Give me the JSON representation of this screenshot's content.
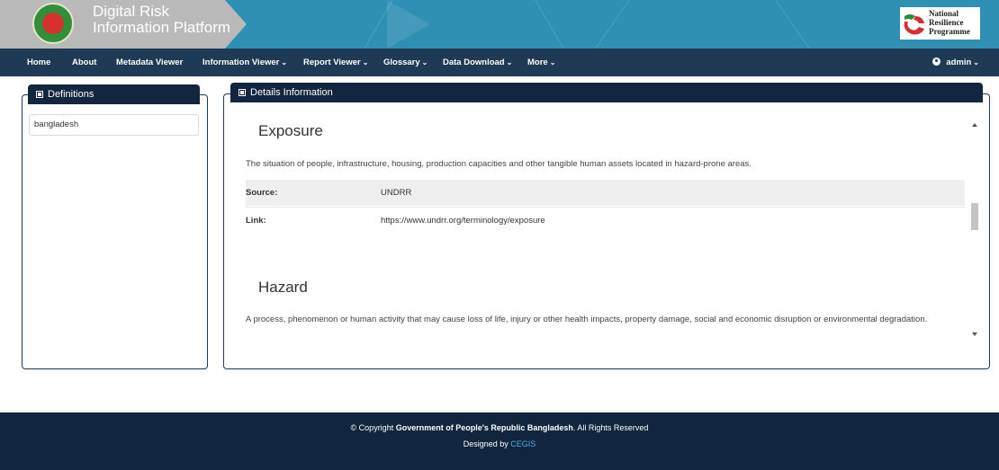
{
  "header": {
    "brand_line1": "Digital Risk",
    "brand_line2": "Information Platform",
    "partner_line1": "National",
    "partner_line2": "Resilience",
    "partner_line3": "Programme"
  },
  "nav": {
    "items": [
      {
        "label": "Home",
        "dropdown": false
      },
      {
        "label": "About",
        "dropdown": false
      },
      {
        "label": "Metadata Viewer",
        "dropdown": false
      },
      {
        "label": "Information Viewer",
        "dropdown": true
      },
      {
        "label": "Report Viewer",
        "dropdown": true
      },
      {
        "label": "Glossary",
        "dropdown": true
      },
      {
        "label": "Data Download",
        "dropdown": true
      },
      {
        "label": "More",
        "dropdown": true
      }
    ],
    "caret": "⌄",
    "user_label": "admin"
  },
  "definitions": {
    "title": "Definitions",
    "items": [
      "bangladesh"
    ]
  },
  "details": {
    "title": "Details Information",
    "entries": [
      {
        "term": "Exposure",
        "description": "The situation of people, infrastructure, housing, production capacities and other tangible human assets located in hazard-prone areas.",
        "source_label": "Source:",
        "source_value": "UNDRR",
        "link_label": "Link:",
        "link_value": "https://www.undrr.org/terminology/exposure"
      },
      {
        "term": "Hazard",
        "description": "A process, phenomenon or human activity that may cause loss of life, injury or other health impacts, property damage, social and economic disruption or environmental degradation."
      }
    ]
  },
  "footer": {
    "copyright_prefix": "© Copyright",
    "copyright_org": "Government of People's Republic Bangladesh",
    "copyright_suffix": ". All Rights Reserved",
    "designed_by": "Designed by",
    "designer": "CEGIS"
  },
  "colors": {
    "banner_blue": "#2f8fb4",
    "nav_dark": "#1e3a55",
    "panel_head": "#13263f",
    "footer": "#11253f",
    "link": "#4ab0e0"
  }
}
